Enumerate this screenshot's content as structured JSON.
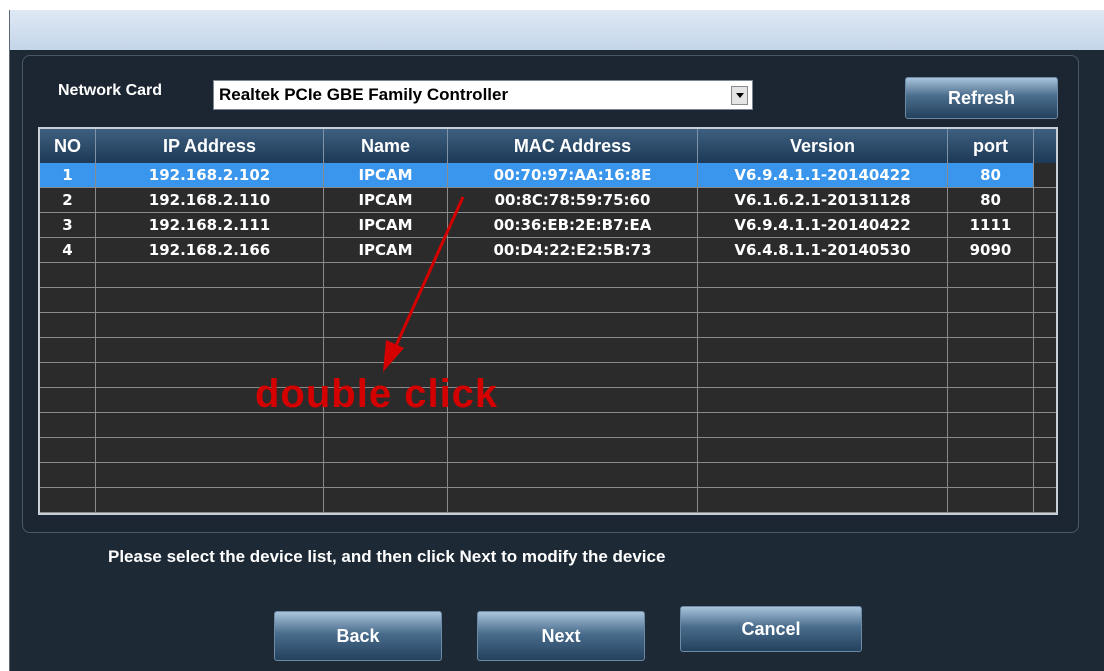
{
  "network_card": {
    "label": "Network Card",
    "selected": "Realtek PCIe GBE Family Controller"
  },
  "buttons": {
    "refresh": "Refresh",
    "back": "Back",
    "next": "Next",
    "cancel": "Cancel"
  },
  "table": {
    "columns": [
      "NO",
      "IP Address",
      "Name",
      "MAC Address",
      "Version",
      "port"
    ],
    "rows": [
      [
        "1",
        "192.168.2.102",
        "IPCAM",
        "00:70:97:AA:16:8E",
        "V6.9.4.1.1-20140422",
        "80"
      ],
      [
        "2",
        "192.168.2.110",
        "IPCAM",
        "00:8C:78:59:75:60",
        "V6.1.6.2.1-20131128",
        "80"
      ],
      [
        "3",
        "192.168.2.111",
        "IPCAM",
        "00:36:EB:2E:B7:EA",
        "V6.9.4.1.1-20140422",
        "1111"
      ],
      [
        "4",
        "192.168.2.166",
        "IPCAM",
        "00:D4:22:E2:5B:73",
        "V6.4.8.1.1-20140530",
        "9090"
      ]
    ],
    "selected_row": 1
  },
  "hint": "Please select the device list, and then click Next to modify the device",
  "annotation": "double click",
  "colors": {
    "selection": "#3a96ec",
    "annotation": "#d40000"
  }
}
